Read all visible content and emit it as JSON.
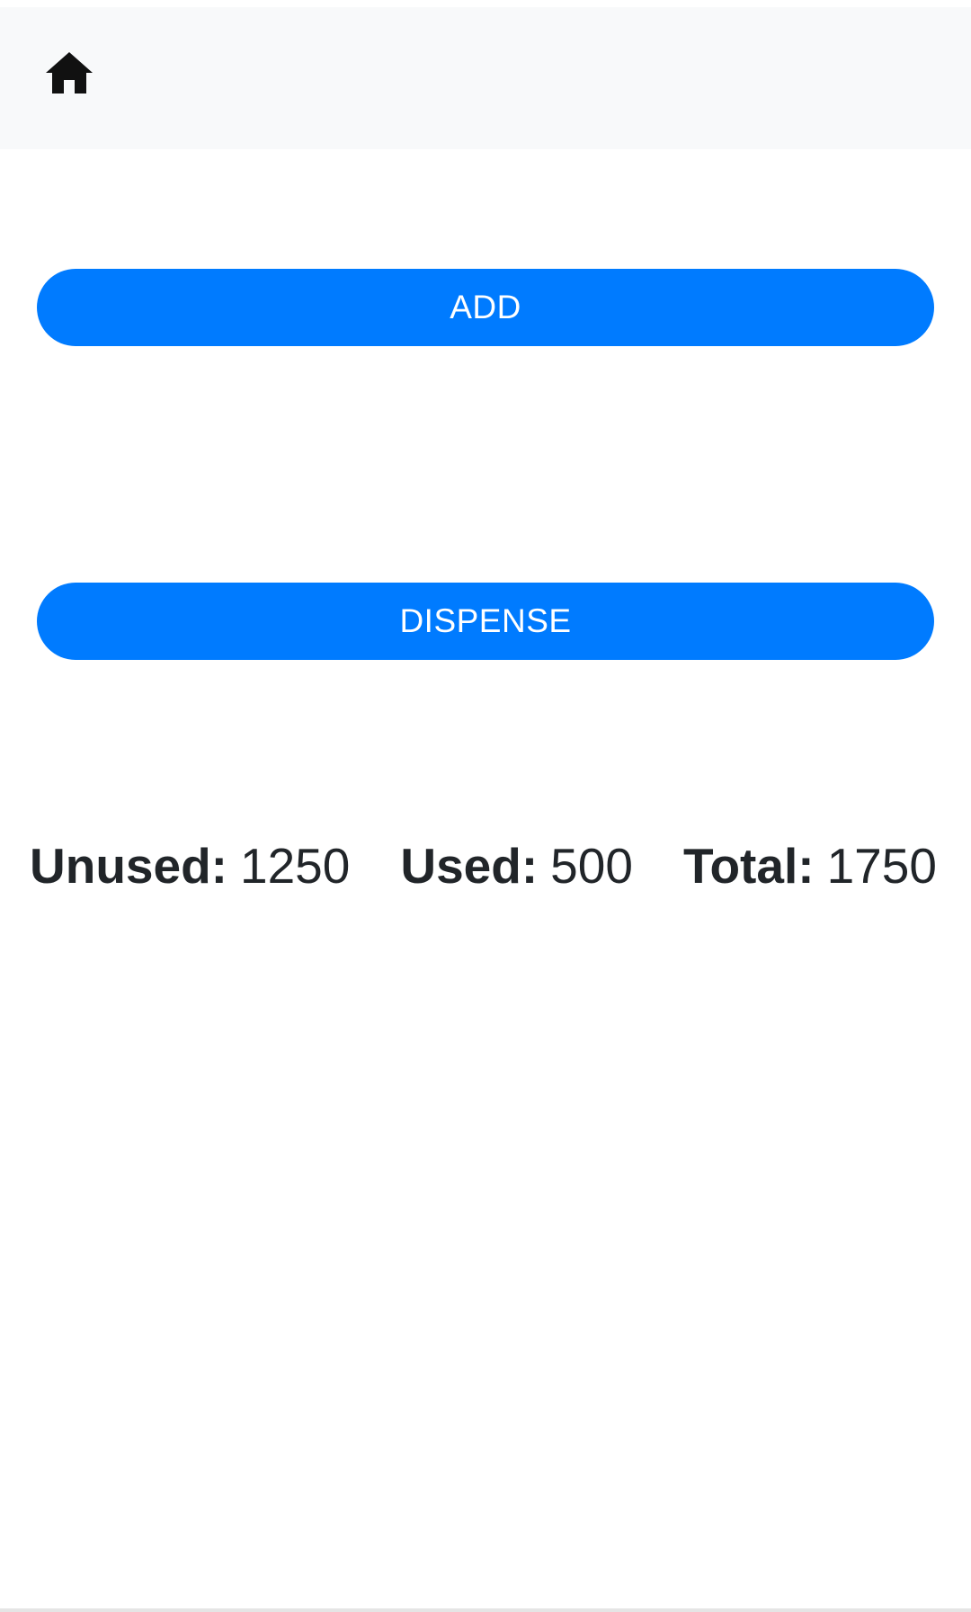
{
  "navbar": {
    "home_icon": "home-icon",
    "background": "#f8f9fa"
  },
  "actions": {
    "add_label": "ADD",
    "dispense_label": "DISPENSE",
    "button_color": "#007bff"
  },
  "stats": {
    "unused_label": "Unused:",
    "unused_value": "1250",
    "used_label": "Used:",
    "used_value": "500",
    "total_label": "Total:",
    "total_value": "1750"
  }
}
